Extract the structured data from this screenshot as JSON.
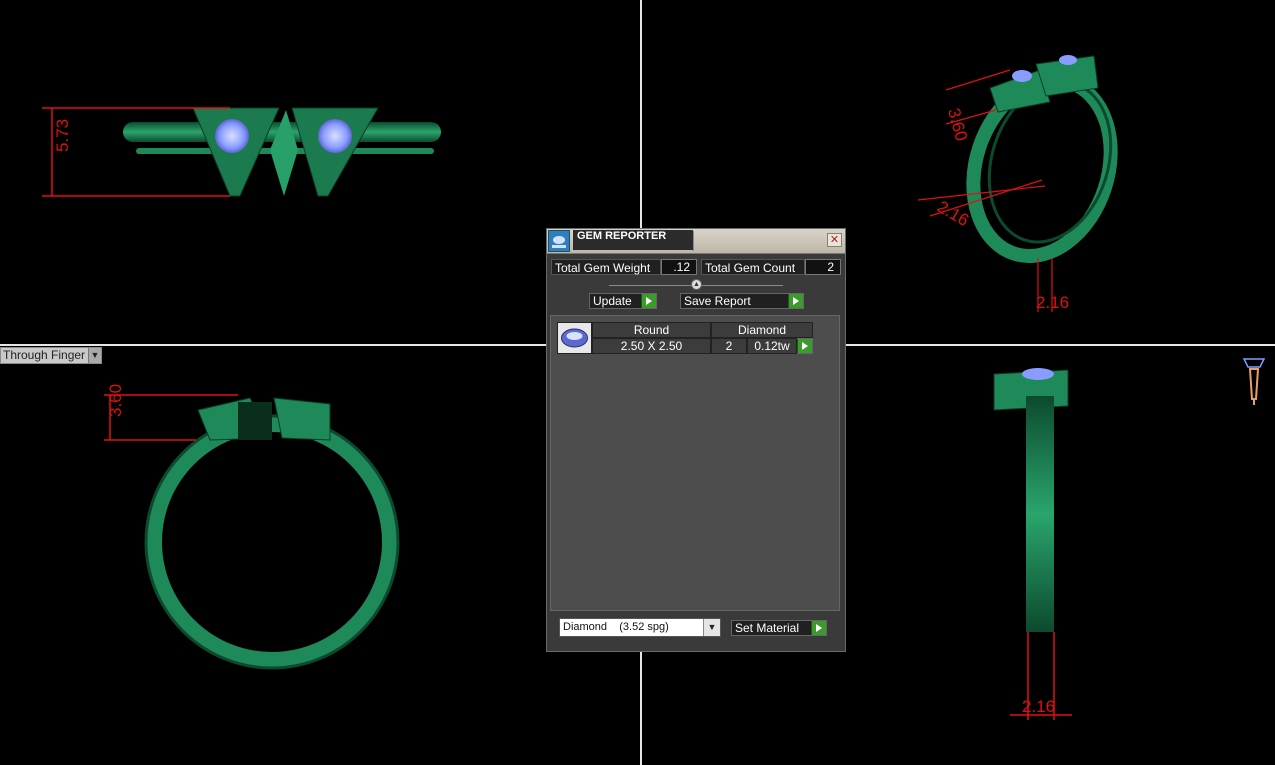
{
  "viewport": {
    "mode_dropdown": "Through Finger"
  },
  "dimensions": {
    "front_height": "5.73",
    "top_view_height": "3.60",
    "persp_height": "3.60",
    "persp_width": "2.16",
    "persp_band": "2.16",
    "side_width": "2.16"
  },
  "dialog": {
    "title": "GEM REPORTER",
    "total_gem_weight_label": "Total Gem Weight",
    "total_gem_weight_value": ".12",
    "total_gem_count_label": "Total Gem Count",
    "total_gem_count_value": "2",
    "update_label": "Update",
    "save_report_label": "Save Report",
    "gems": [
      {
        "shape": "Round",
        "size": "2.50 X 2.50",
        "material": "Diamond",
        "count": "2",
        "weight": "0.12tw"
      }
    ],
    "material_selected": "Diamond    (3.52 spg)",
    "set_material_label": "Set Material"
  },
  "colors": {
    "metal": "#1e8a5a",
    "gem": "#8a9cff",
    "dimension": "#e01010",
    "accent_button": "#3d9a2c"
  }
}
